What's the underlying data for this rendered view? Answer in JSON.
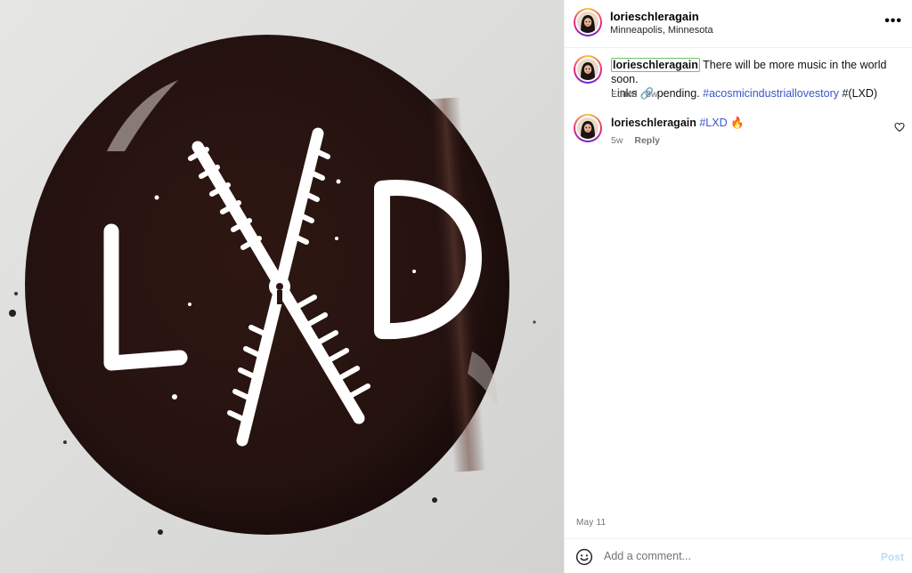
{
  "post": {
    "username": "lorieschleragain",
    "location": "Minneapolis, Minnesota",
    "more_icon": "more-horizontal-icon"
  },
  "caption": {
    "username": "lorieschleragain",
    "text_1": "There will be more music in the world soon.",
    "text_2": "Links 🔗 pending.",
    "hashtag": "#acosmicindustriallovestory",
    "text_3": "#(LXD)",
    "edited": "Edited",
    "time": "3w"
  },
  "comment": {
    "username": "lorieschleragain",
    "hashtag": "#LXD",
    "emoji": "🔥",
    "time": "5w",
    "reply_label": "Reply",
    "like_icon": "heart-icon"
  },
  "date": "May 11",
  "footer": {
    "placeholder": "Add a comment...",
    "post_label": "Post",
    "emoji_icon": "smiley-icon"
  },
  "media": {
    "logo_letters": [
      "L",
      "D"
    ],
    "colors": {
      "disc": "#2a1410",
      "mark": "#ffffff",
      "background": "#dcdcdc"
    }
  },
  "colors": {
    "link": "#3a56c9",
    "muted": "#737373",
    "post_disabled": "#b2dffc"
  }
}
